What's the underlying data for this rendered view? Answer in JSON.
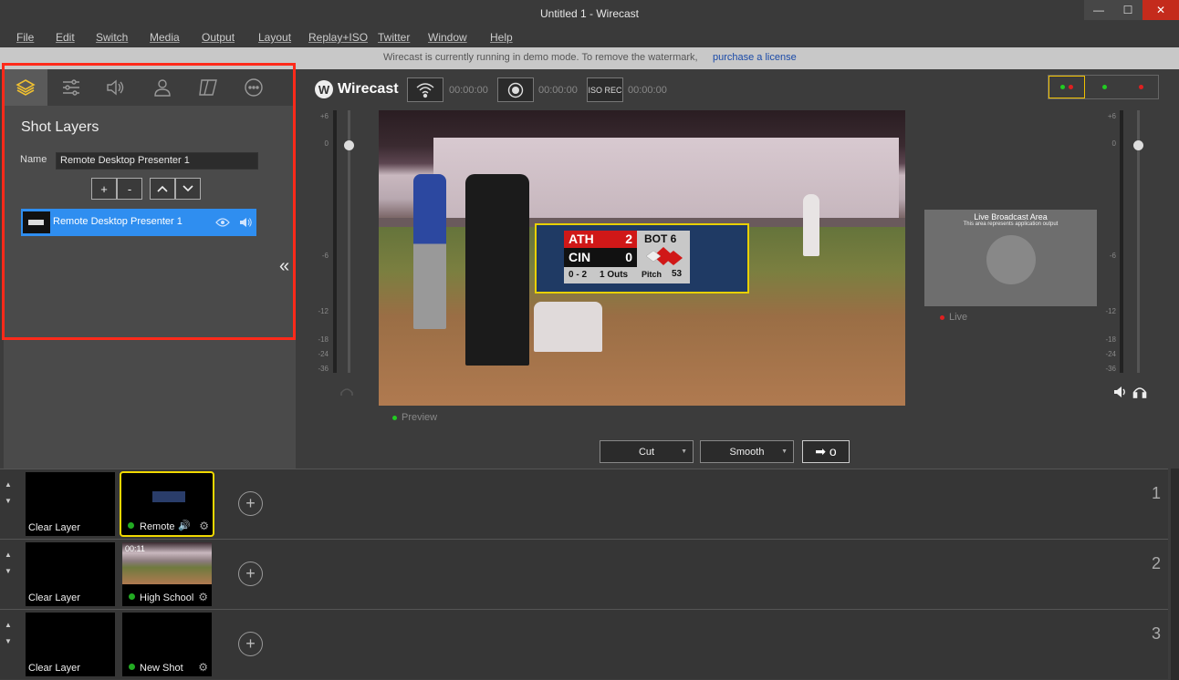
{
  "window": {
    "title": "Untitled 1 - Wirecast",
    "minimize": "—",
    "maximize": "☐",
    "close": "✕"
  },
  "menu": [
    "File",
    "Edit",
    "Switch",
    "Media",
    "Output",
    "Layout",
    "Replay+ISO",
    "Twitter",
    "Window",
    "Help"
  ],
  "banner": {
    "text": "Wirecast is currently running in demo mode. To remove the watermark,",
    "link": "purchase a license"
  },
  "left_panel": {
    "tabs": [
      "layers-icon",
      "sliders-icon",
      "speaker-icon",
      "person-icon",
      "text-icon",
      "more-icon"
    ],
    "title": "Shot Layers",
    "name_label": "Name",
    "name_value": "Remote Desktop Presenter 1",
    "buttons": {
      "add": "+",
      "remove": "-",
      "up": "∧",
      "down": "∨"
    },
    "layer_item": "Remote Desktop Presenter 1",
    "collapse": "«"
  },
  "toolbar": {
    "app_name": "Wirecast",
    "stream_time": "00:00:00",
    "record_time": "00:00:00",
    "iso_label": "ISO REC",
    "iso_time": "00:00:00"
  },
  "meters": {
    "ticks": [
      "+6",
      "0",
      "-6",
      "-12",
      "-18",
      "-24",
      "-36"
    ]
  },
  "preview": {
    "label": "Preview",
    "scoreboard": {
      "team1": "ATH",
      "score1": "2",
      "team2": "CIN",
      "score2": "0",
      "count": "0 - 2",
      "outs": "1 Outs",
      "inning": "BOT 6",
      "pitch_label": "Pitch",
      "pitch_value": "53"
    }
  },
  "live": {
    "heading": "Live Broadcast Area",
    "subtext": "This area represents application output",
    "label": "Live"
  },
  "transitions": {
    "cut": "Cut",
    "smooth": "Smooth",
    "go": "➡ o"
  },
  "layers": [
    {
      "number": "1",
      "clear": "Clear Layer",
      "shot": "Remote",
      "shot_live": true
    },
    {
      "number": "2",
      "clear": "Clear Layer",
      "shot": "High School B",
      "shot_time": "00:11",
      "shot_live": true
    },
    {
      "number": "3",
      "clear": "Clear Layer",
      "shot": "New Shot",
      "shot_live": true
    }
  ],
  "colors": {
    "accent_blue": "#2f8ef0",
    "highlight_red": "#ff2a1a",
    "selected_yellow": "#f0d800"
  }
}
